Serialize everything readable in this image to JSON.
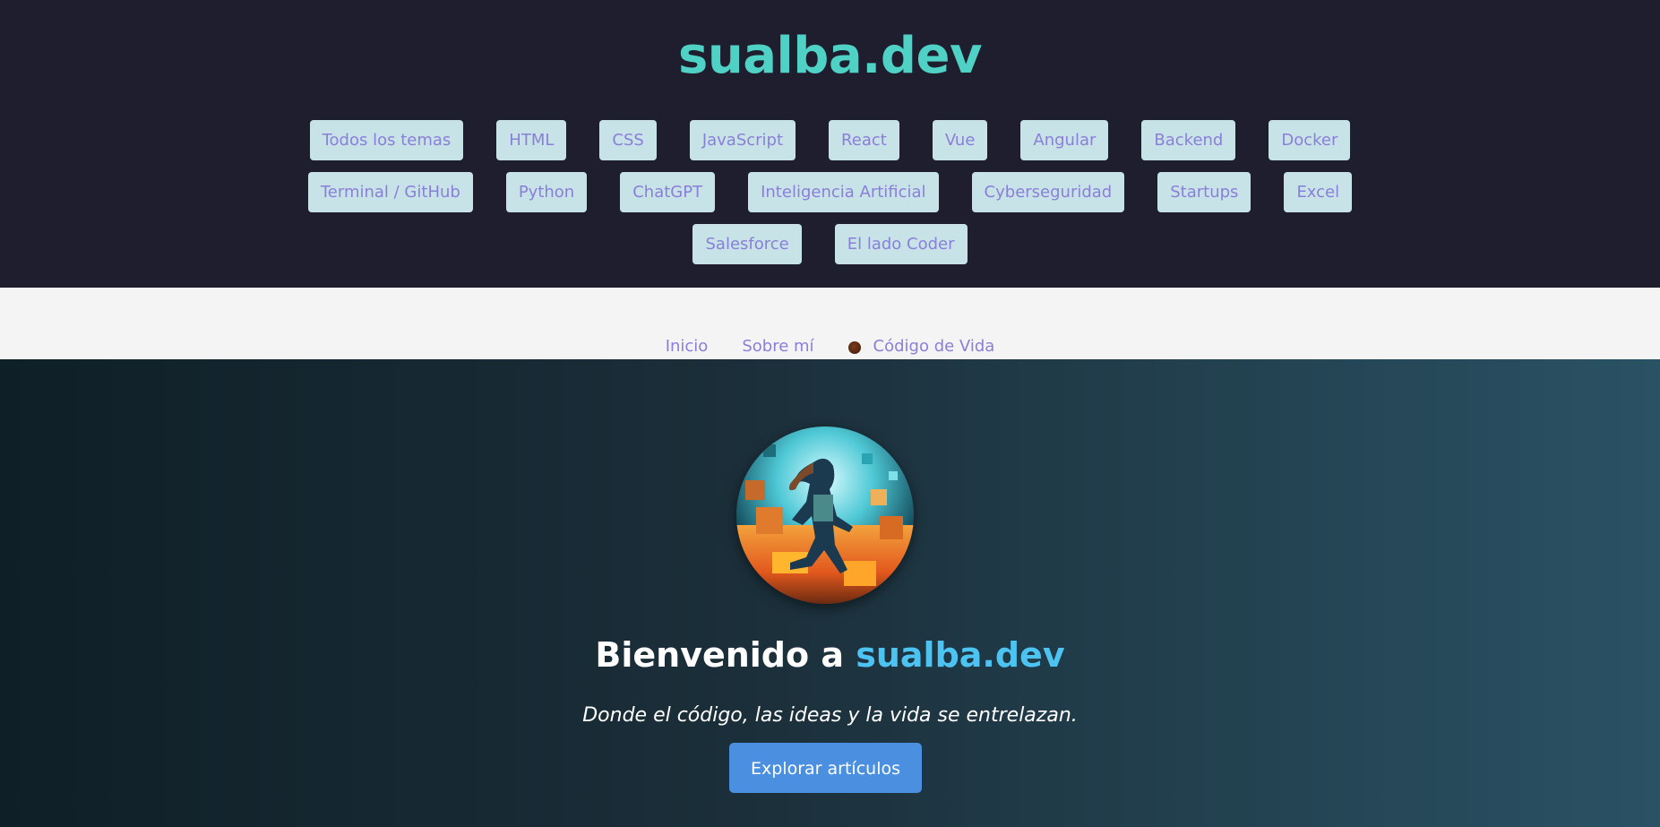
{
  "header": {
    "site_title": "sualba.dev",
    "tags": [
      "Todos los temas",
      "HTML",
      "CSS",
      "JavaScript",
      "React",
      "Vue",
      "Angular",
      "Backend",
      "Docker",
      "Terminal / GitHub",
      "Python",
      "ChatGPT",
      "Inteligencia Artificial",
      "Cyberseguridad",
      "Startups",
      "Excel",
      "Salesforce",
      "El lado Coder"
    ]
  },
  "nav": {
    "items": [
      {
        "label": "Inicio",
        "icon": null
      },
      {
        "label": "Sobre mí",
        "icon": null
      },
      {
        "label": "Código de Vida",
        "icon": "coffee-icon"
      }
    ]
  },
  "hero": {
    "title_prefix": "Bienvenido a ",
    "title_brand": "sualba.dev",
    "subtitle": "Donde el código, las ideas y la vida se entrelazan.",
    "cta_label": "Explorar artículos"
  },
  "colors": {
    "header_bg": "#1e1e2f",
    "brand_teal": "#4fd1c5",
    "tag_bg": "#c8e3e8",
    "tag_text": "#8a7fd8",
    "hero_brand": "#4dc3f2",
    "cta_bg": "#4a8fe0"
  }
}
